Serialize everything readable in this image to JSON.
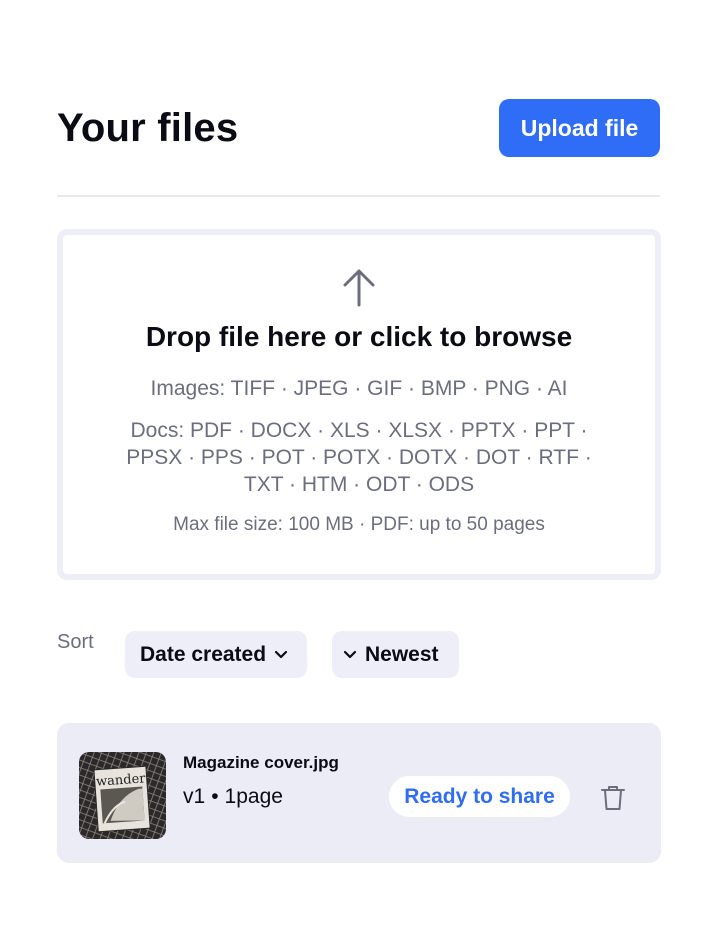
{
  "header": {
    "title": "Your files",
    "upload_label": "Upload file"
  },
  "dropzone": {
    "icon": "arrow-up-icon",
    "title": "Drop file here or click to browse",
    "images_formats": "Images: TIFF · JPEG · GIF · BMP · PNG · AI",
    "docs_formats": "Docs: PDF · DOCX · XLS · XLSX · PPTX · PPT · PPSX · PPS · POT · POTX · DOTX · DOT · RTF · TXT · HTM · ODT · ODS",
    "limits": "Max file size: 100 MB · PDF: up to 50 pages"
  },
  "sort": {
    "label": "Sort",
    "field_value": "Date created",
    "order_value": "Newest"
  },
  "files": [
    {
      "name": "Magazine cover.jpg",
      "version": "v1",
      "pages": "1page",
      "status": "Ready to share",
      "thumbnail_text": "wander"
    }
  ],
  "colors": {
    "accent": "#2f6df6",
    "card_bg": "#ececf7",
    "muted_text": "#6c6e7e"
  }
}
